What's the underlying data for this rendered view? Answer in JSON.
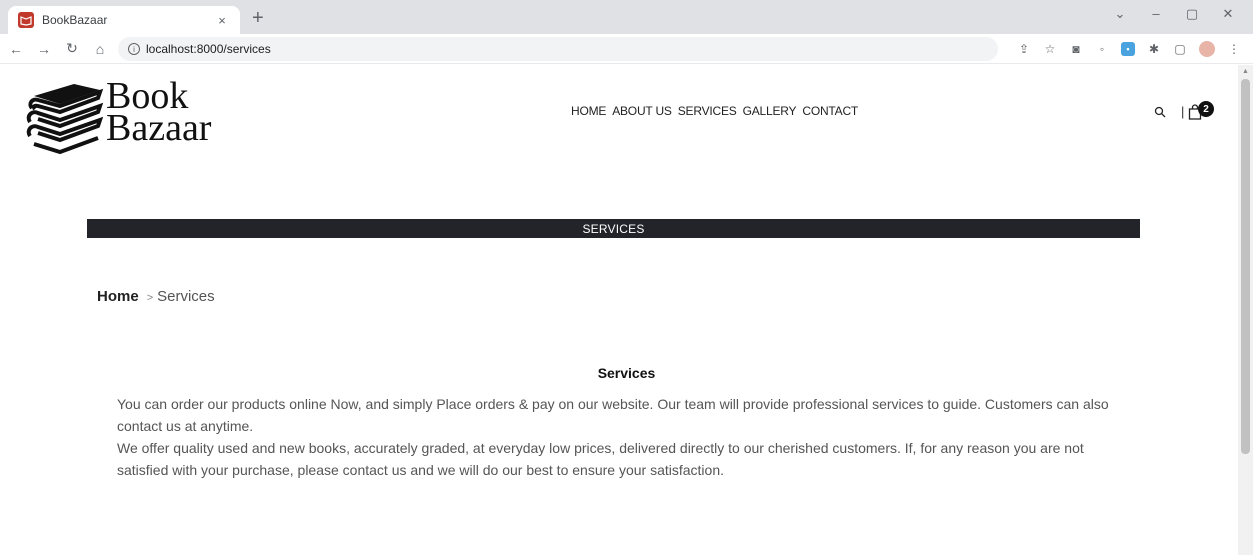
{
  "browser": {
    "tab_title": "BookBazaar",
    "tab_close": "×",
    "new_tab": "+",
    "url": "localhost:8000/services",
    "window_controls": [
      "⌄",
      "–",
      "▢",
      "✕"
    ]
  },
  "site": {
    "logo_word1": "Book",
    "logo_word2": "Bazaar",
    "nav": [
      "HOME",
      "ABOUT US",
      "SERVICES",
      "GALLERY",
      "CONTACT"
    ],
    "cart_count": "2",
    "divider": "|"
  },
  "banner": {
    "label": "SERVICES"
  },
  "breadcrumb": {
    "home": "Home",
    "separator": ">",
    "current": "Services"
  },
  "content": {
    "title": "Services",
    "paragraph1": "You can order our products online Now, and simply Place orders & pay on our website. Our team will provide professional services to guide. Customers can also contact us at anytime.",
    "paragraph2": "We offer quality used and new books, accurately graded, at everyday low prices, delivered directly to our cherished customers. If, for any reason you are not satisfied with your purchase, please contact us and we will do our best to ensure your satisfaction."
  },
  "colors": {
    "banner_bg": "#23242a",
    "text_muted": "#555555",
    "favicon": "#c0392b"
  }
}
